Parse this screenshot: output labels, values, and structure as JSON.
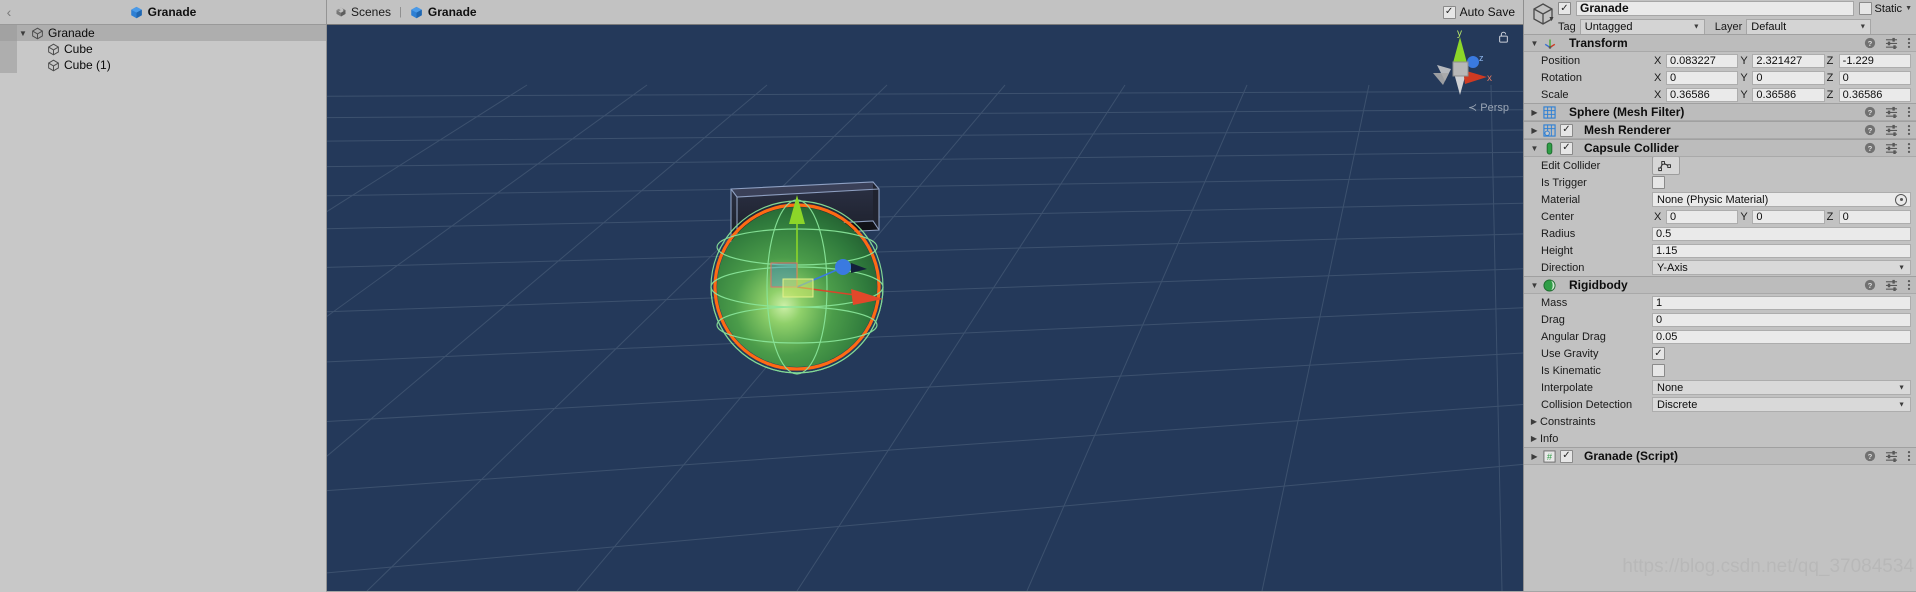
{
  "hierarchy": {
    "back_icon": "chevron-left-icon",
    "tab_label": "Granade",
    "items": [
      {
        "label": "Granade",
        "depth": 0,
        "expanded": true,
        "selected": true,
        "icon": "prefab-cube-icon"
      },
      {
        "label": "Cube",
        "depth": 1,
        "expanded": false,
        "selected": false,
        "icon": "prefab-cube-icon"
      },
      {
        "label": "Cube (1)",
        "depth": 1,
        "expanded": false,
        "selected": false,
        "icon": "prefab-cube-icon"
      }
    ]
  },
  "scene": {
    "breadcrumb_scenes": "Scenes",
    "breadcrumb_separator": "|",
    "breadcrumb_object": "Granade",
    "auto_save_label": "Auto Save",
    "auto_save_checked": true,
    "projection_label": "Persp",
    "projection_prefix": "≺",
    "gizmo_axes": [
      "y",
      "z",
      "x"
    ],
    "background_color": "#24395a",
    "selection_outline_color": "#ff6a14",
    "gizmo_y_color": "#8cd629",
    "gizmo_x_color": "#cf3a22",
    "gizmo_z_color": "#3a7ae0",
    "collider_wire_color": "#8ae69b"
  },
  "inspector": {
    "object_name": "Granade",
    "object_enabled": true,
    "static_label": "Static",
    "static_checked": false,
    "tag_label": "Tag",
    "tag_value": "Untagged",
    "layer_label": "Layer",
    "layer_value": "Default",
    "components": [
      {
        "id": "transform",
        "title": "Transform",
        "icon": "transform-axis-icon",
        "expanded": true,
        "has_enable_checkbox": false,
        "rows": [
          {
            "type": "vector3",
            "label": "Position",
            "axes": [
              "X",
              "Y",
              "Z"
            ],
            "values": [
              "0.083227",
              "2.321427",
              "-1.229"
            ]
          },
          {
            "type": "vector3",
            "label": "Rotation",
            "axes": [
              "X",
              "Y",
              "Z"
            ],
            "values": [
              "0",
              "0",
              "0"
            ]
          },
          {
            "type": "vector3",
            "label": "Scale",
            "axes": [
              "X",
              "Y",
              "Z"
            ],
            "values": [
              "0.36586",
              "0.36586",
              "0.36586"
            ]
          }
        ]
      },
      {
        "id": "mesh-filter",
        "title": "Sphere (Mesh Filter)",
        "icon": "mesh-filter-icon",
        "expanded": false,
        "has_enable_checkbox": false,
        "rows": []
      },
      {
        "id": "mesh-renderer",
        "title": "Mesh Renderer",
        "icon": "mesh-renderer-icon",
        "expanded": false,
        "has_enable_checkbox": true,
        "enabled": true,
        "rows": []
      },
      {
        "id": "capsule-collider",
        "title": "Capsule Collider",
        "icon": "capsule-collider-icon",
        "expanded": true,
        "has_enable_checkbox": true,
        "enabled": true,
        "rows": [
          {
            "type": "button",
            "label": "Edit Collider",
            "icon": "edit-collider-icon"
          },
          {
            "type": "checkbox",
            "label": "Is Trigger",
            "checked": false
          },
          {
            "type": "object",
            "label": "Material",
            "value": "None (Physic Material)"
          },
          {
            "type": "vector3",
            "label": "Center",
            "axes": [
              "X",
              "Y",
              "Z"
            ],
            "values": [
              "0",
              "0",
              "0"
            ]
          },
          {
            "type": "text",
            "label": "Radius",
            "value": "0.5"
          },
          {
            "type": "text",
            "label": "Height",
            "value": "1.15"
          },
          {
            "type": "dropdown",
            "label": "Direction",
            "value": "Y-Axis"
          }
        ]
      },
      {
        "id": "rigidbody",
        "title": "Rigidbody",
        "icon": "rigidbody-icon",
        "expanded": true,
        "has_enable_checkbox": false,
        "rows": [
          {
            "type": "text",
            "label": "Mass",
            "value": "1"
          },
          {
            "type": "text",
            "label": "Drag",
            "value": "0"
          },
          {
            "type": "text",
            "label": "Angular Drag",
            "value": "0.05"
          },
          {
            "type": "checkbox",
            "label": "Use Gravity",
            "checked": true
          },
          {
            "type": "checkbox",
            "label": "Is Kinematic",
            "checked": false
          },
          {
            "type": "dropdown",
            "label": "Interpolate",
            "value": "None"
          },
          {
            "type": "dropdown",
            "label": "Collision Detection",
            "value": "Discrete"
          },
          {
            "type": "foldout",
            "label": "Constraints",
            "expanded": false
          },
          {
            "type": "foldout",
            "label": "Info",
            "expanded": false
          }
        ]
      },
      {
        "id": "granade-script",
        "title": "Granade (Script)",
        "icon": "script-icon",
        "expanded": false,
        "has_enable_checkbox": true,
        "enabled": true,
        "rows": []
      }
    ]
  },
  "watermark": "https://blog.csdn.net/qq_37084534"
}
